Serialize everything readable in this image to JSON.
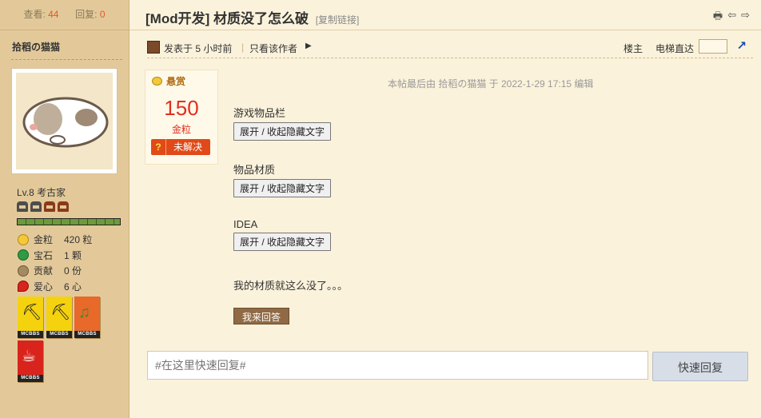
{
  "sidebar": {
    "views_label": "查看:",
    "views_value": "44",
    "replies_label": "回复:",
    "replies_value": "0",
    "author": "拾稻の猫猫",
    "level": "Lv.8 考古家",
    "stats": [
      {
        "label": "金粒",
        "value": "420 粒"
      },
      {
        "label": "宝石",
        "value": "1 颗"
      },
      {
        "label": "贡献",
        "value": "0 份"
      },
      {
        "label": "爱心",
        "value": "6 心"
      }
    ],
    "medal_caption": "MCBBS",
    "xp_fraction": 1.0
  },
  "header": {
    "title": "[Mod开发] 材质没了怎么破",
    "copy_link": "[复制链接]"
  },
  "infobar": {
    "posted": "发表于 5 小时前",
    "separator": "|",
    "only_author": "只看该作者",
    "floor": "楼主",
    "elevator": "电梯直达"
  },
  "bounty": {
    "label": "悬赏",
    "amount": "150",
    "unit": "金粒",
    "status_q": "?",
    "status": "未解决"
  },
  "post": {
    "last_edit": "本帖最后由 拾稻の猫猫 于 2022-1-29 17:15 编辑",
    "sections": [
      {
        "label": "游戏物品栏",
        "button": "展开 / 收起隐藏文字"
      },
      {
        "label": "物品材质",
        "button": "展开 / 收起隐藏文字"
      },
      {
        "label": "IDEA",
        "button": "展开 / 收起隐藏文字"
      }
    ],
    "text": "我的材质就这么没了。。。",
    "answer_button": "我来回答"
  },
  "reply": {
    "placeholder": "#在这里快速回复#",
    "button": "快速回复"
  },
  "colors": {
    "sidebar_bg": "#e3c99a",
    "main_bg": "#fbf2db",
    "accent_red": "#e0301e"
  }
}
